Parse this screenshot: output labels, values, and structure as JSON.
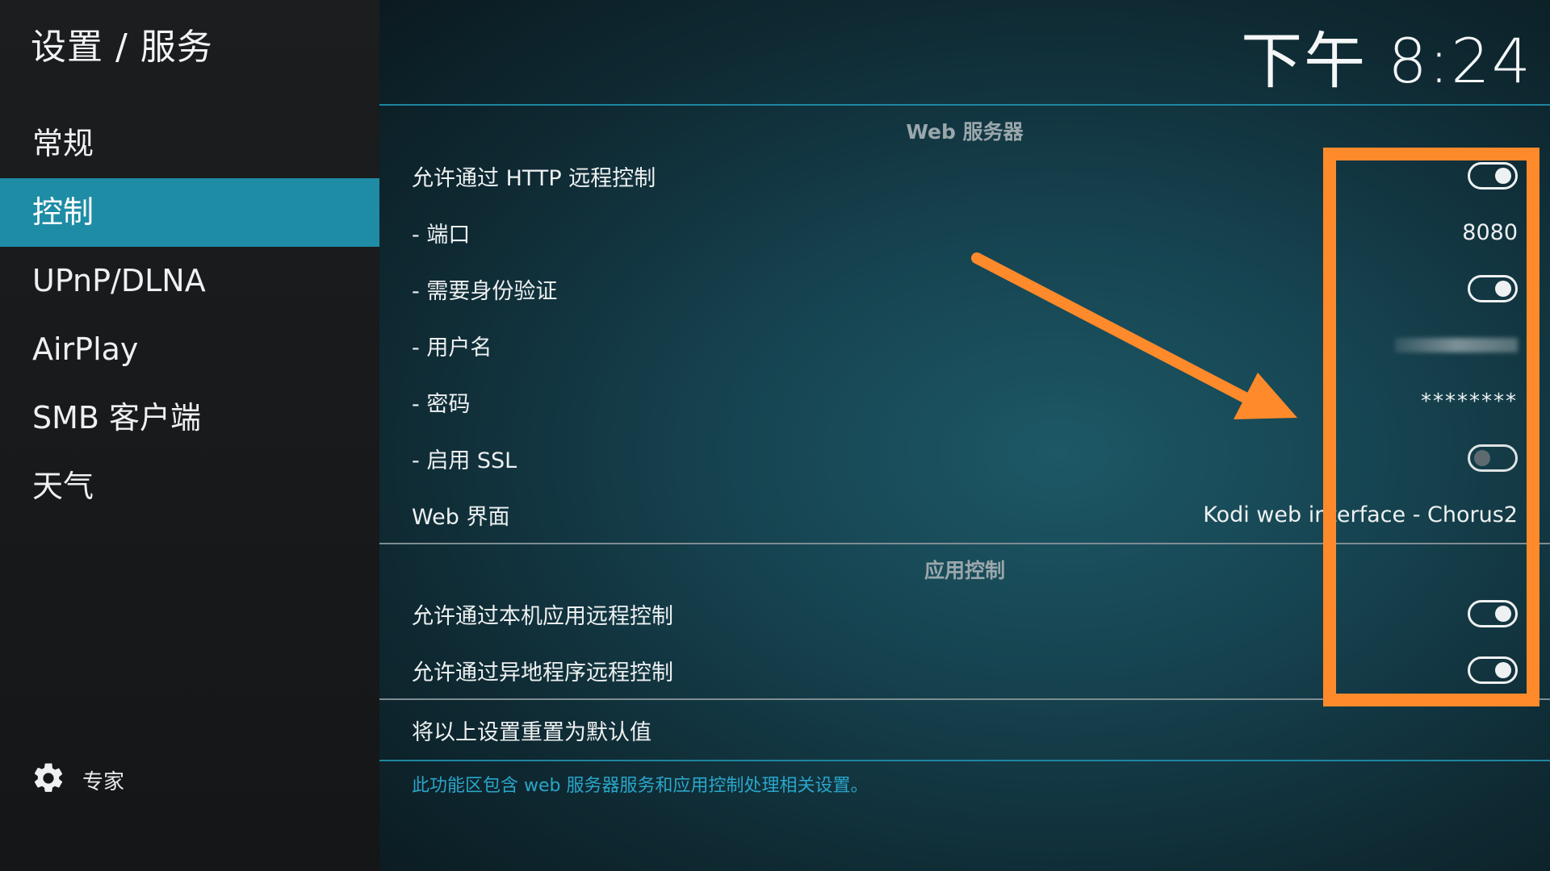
{
  "header": {
    "breadcrumb": "设置 / 服务",
    "clock": "下午 8:24"
  },
  "sidebar": {
    "items": [
      {
        "label": "常规",
        "active": false
      },
      {
        "label": "控制",
        "active": true
      },
      {
        "label": "UPnP/DLNA",
        "active": false
      },
      {
        "label": "AirPlay",
        "active": false
      },
      {
        "label": "SMB 客户端",
        "active": false
      },
      {
        "label": "天气",
        "active": false
      }
    ],
    "settings_level": {
      "label": "专家",
      "icon": "gear-icon"
    }
  },
  "sections": {
    "web_server": {
      "title": "Web 服务器",
      "allow_http": {
        "label": "允许通过 HTTP 远程控制",
        "enabled": true
      },
      "port": {
        "label": "- 端口",
        "value": "8080"
      },
      "auth": {
        "label": "- 需要身份验证",
        "enabled": true
      },
      "username": {
        "label": "- 用户名"
      },
      "password": {
        "label": "- 密码",
        "value": "********"
      },
      "ssl": {
        "label": "- 启用 SSL",
        "enabled": false
      },
      "web_interface": {
        "label": "Web 界面",
        "value": "Kodi web interface - Chorus2"
      }
    },
    "app_control": {
      "title": "应用控制",
      "local_apps": {
        "label": "允许通过本机应用远程控制",
        "enabled": true
      },
      "remote_apps": {
        "label": "允许通过异地程序远程控制",
        "enabled": true
      }
    },
    "reset": {
      "label": "将以上设置重置为默认值"
    }
  },
  "help_text": "此功能区包含 web 服务器服务和应用控制处理相关设置。",
  "colors": {
    "accent": "#1f8ca6",
    "annotation": "#ff8a2b",
    "help_text": "#2aa6c9"
  }
}
